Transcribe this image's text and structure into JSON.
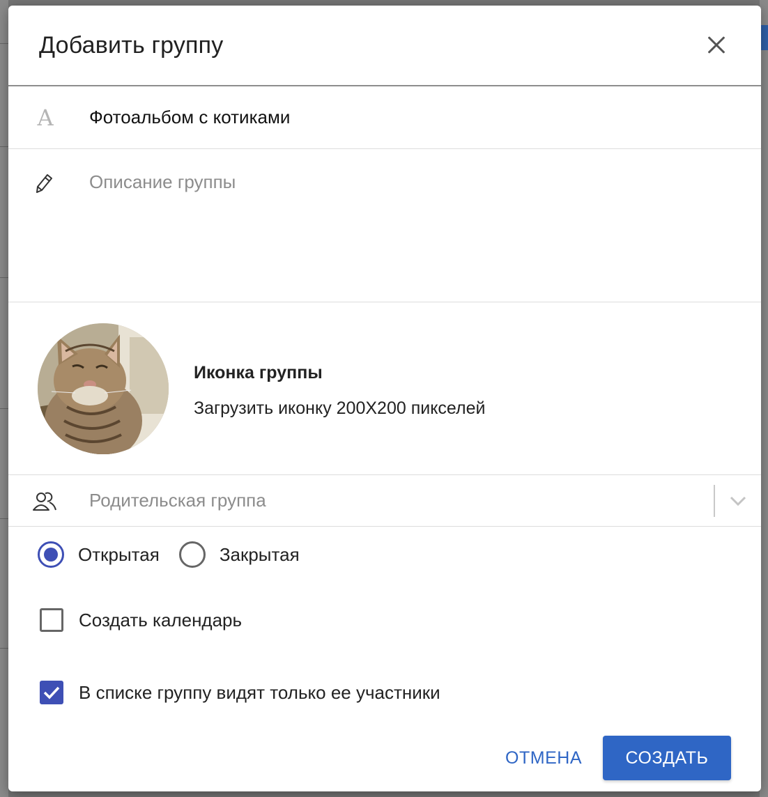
{
  "dialog": {
    "title": "Добавить группу",
    "close_icon": "close-icon"
  },
  "form": {
    "name": {
      "value": "Фотоальбом с котиками",
      "icon": "text-font-icon",
      "icon_glyph": "A"
    },
    "description": {
      "placeholder": "Описание группы",
      "value": "",
      "icon": "pencil-icon"
    },
    "group_icon": {
      "title": "Иконка группы",
      "subtitle": "Загрузить иконку 200X200 пикселей",
      "image": "cat-photo"
    },
    "parent_group": {
      "placeholder": "Родительская группа",
      "icon": "users-icon",
      "arrow_icon": "chevron-down-icon"
    },
    "visibility": {
      "options": [
        {
          "label": "Открытая",
          "checked": true
        },
        {
          "label": "Закрытая",
          "checked": false
        }
      ]
    },
    "create_calendar": {
      "label": "Создать календарь",
      "checked": false
    },
    "members_only": {
      "label": "В списке группу видят только ее участники",
      "checked": true
    }
  },
  "actions": {
    "cancel_label": "ОТМЕНА",
    "create_label": "СОЗДАТЬ"
  },
  "colors": {
    "accent": "#2f66c5",
    "control_checked": "#3e4fb5",
    "placeholder": "#8c8c8c"
  }
}
